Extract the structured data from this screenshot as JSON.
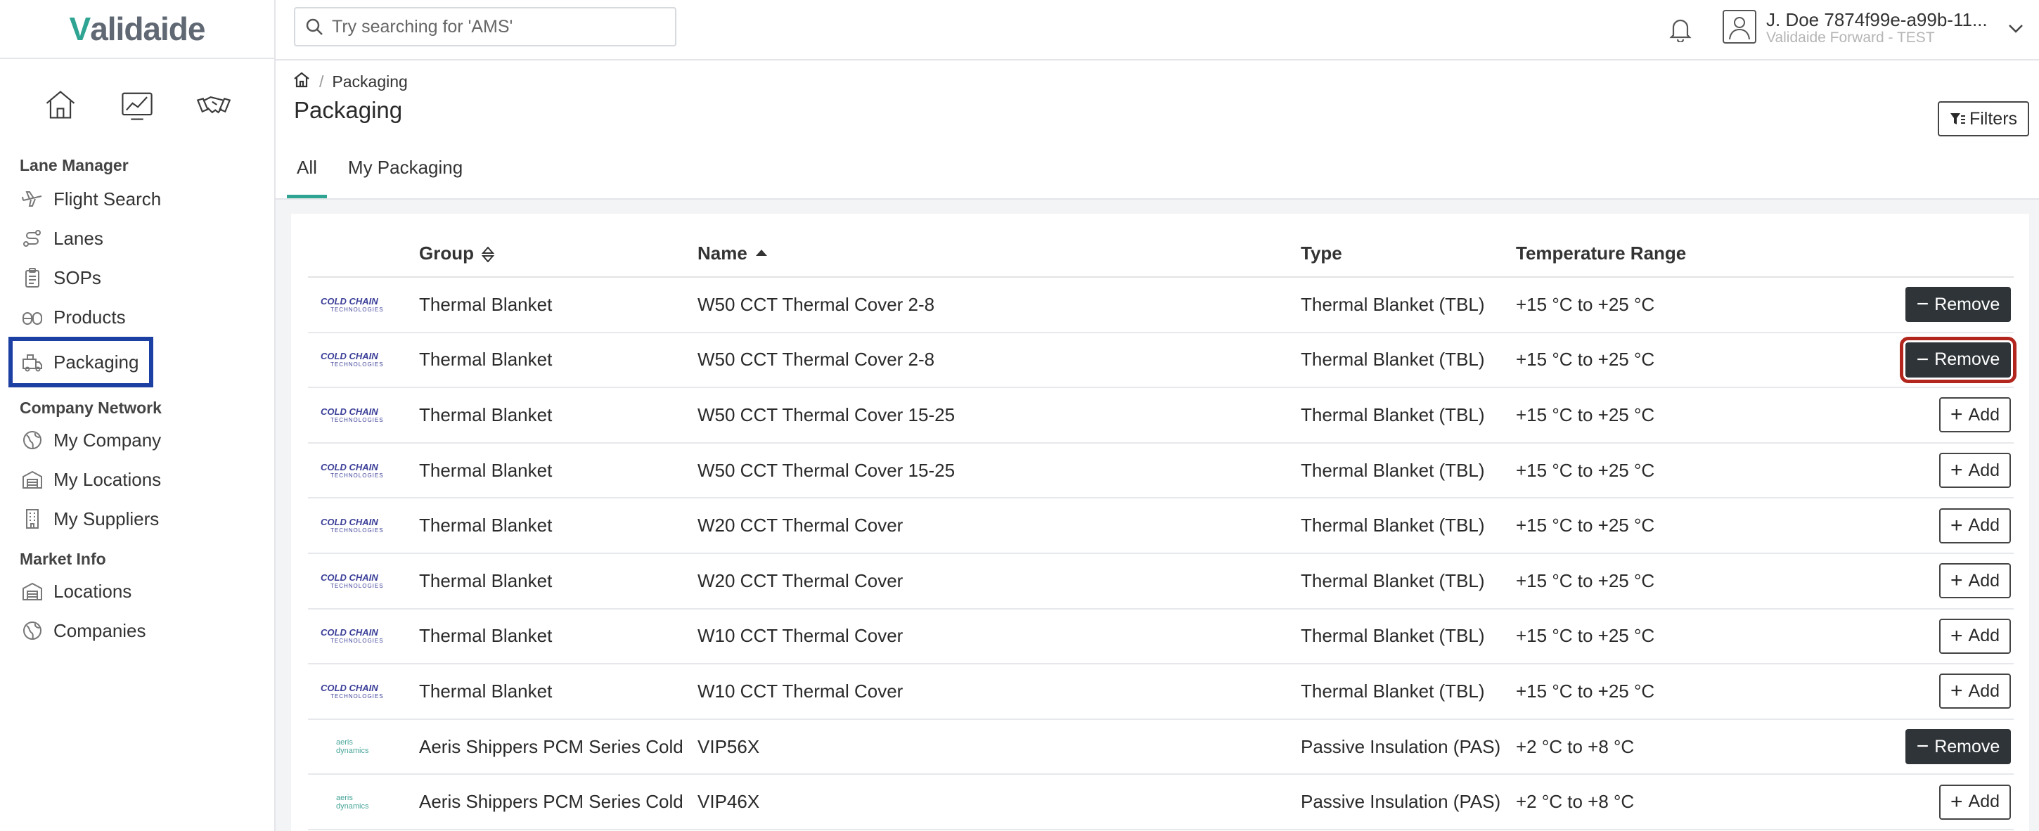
{
  "app": {
    "logo": "Validaide"
  },
  "search": {
    "placeholder": "Try searching for 'AMS'"
  },
  "user": {
    "name": "J. Doe 7874f99e-a99b-11...",
    "org": "Validaide Forward - TEST"
  },
  "sidebar": {
    "sections": [
      {
        "title": "Lane Manager",
        "items": [
          "Flight Search",
          "Lanes",
          "SOPs",
          "Products",
          "Packaging"
        ]
      },
      {
        "title": "Company Network",
        "items": [
          "My Company",
          "My Locations",
          "My Suppliers"
        ]
      },
      {
        "title": "Market Info",
        "items": [
          "Locations",
          "Companies"
        ]
      }
    ],
    "active": "Packaging"
  },
  "breadcrumb": {
    "current": "Packaging"
  },
  "page": {
    "title": "Packaging",
    "filters_label": "Filters"
  },
  "tabs": [
    {
      "label": "All",
      "active": true
    },
    {
      "label": "My Packaging",
      "active": false
    }
  ],
  "table": {
    "headers": {
      "group": "Group",
      "name": "Name",
      "type": "Type",
      "temp": "Temperature Range"
    },
    "rows": [
      {
        "brand": "cct",
        "group": "Thermal Blanket",
        "name": "W50 CCT Thermal Cover 2-8",
        "type": "Thermal Blanket (TBL)",
        "temp": "+15 °C to +25 °C",
        "action": "Remove"
      },
      {
        "brand": "cct",
        "group": "Thermal Blanket",
        "name": "W50 CCT Thermal Cover 2-8",
        "type": "Thermal Blanket (TBL)",
        "temp": "+15 °C to +25 °C",
        "action": "Remove"
      },
      {
        "brand": "cct",
        "group": "Thermal Blanket",
        "name": "W50 CCT Thermal Cover 15-25",
        "type": "Thermal Blanket (TBL)",
        "temp": "+15 °C to +25 °C",
        "action": "Add"
      },
      {
        "brand": "cct",
        "group": "Thermal Blanket",
        "name": "W50 CCT Thermal Cover 15-25",
        "type": "Thermal Blanket (TBL)",
        "temp": "+15 °C to +25 °C",
        "action": "Add"
      },
      {
        "brand": "cct",
        "group": "Thermal Blanket",
        "name": "W20 CCT Thermal Cover",
        "type": "Thermal Blanket (TBL)",
        "temp": "+15 °C to +25 °C",
        "action": "Add"
      },
      {
        "brand": "cct",
        "group": "Thermal Blanket",
        "name": "W20 CCT Thermal Cover",
        "type": "Thermal Blanket (TBL)",
        "temp": "+15 °C to +25 °C",
        "action": "Add"
      },
      {
        "brand": "cct",
        "group": "Thermal Blanket",
        "name": "W10 CCT Thermal Cover",
        "type": "Thermal Blanket (TBL)",
        "temp": "+15 °C to +25 °C",
        "action": "Add"
      },
      {
        "brand": "cct",
        "group": "Thermal Blanket",
        "name": "W10 CCT Thermal Cover",
        "type": "Thermal Blanket (TBL)",
        "temp": "+15 °C to +25 °C",
        "action": "Add"
      },
      {
        "brand": "aeris",
        "group": "Aeris Shippers PCM Series Cold",
        "name": "VIP56X",
        "type": "Passive Insulation (PAS)",
        "temp": "+2 °C to +8 °C",
        "action": "Remove"
      },
      {
        "brand": "aeris",
        "group": "Aeris Shippers PCM Series Cold",
        "name": "VIP46X",
        "type": "Passive Insulation (PAS)",
        "temp": "+2 °C to +8 °C",
        "action": "Add"
      }
    ]
  },
  "brands": {
    "cct": {
      "line1": "COLD CHAIN",
      "line2": "TECHNOLOGIES"
    },
    "aeris": {
      "line1": "aeris",
      "line2": "dynamics"
    }
  },
  "colors": {
    "accent": "#2fa493",
    "highlight_nav": "#1c3fa3",
    "highlight_button": "#b3261e",
    "remove_button": "#2f3438"
  }
}
